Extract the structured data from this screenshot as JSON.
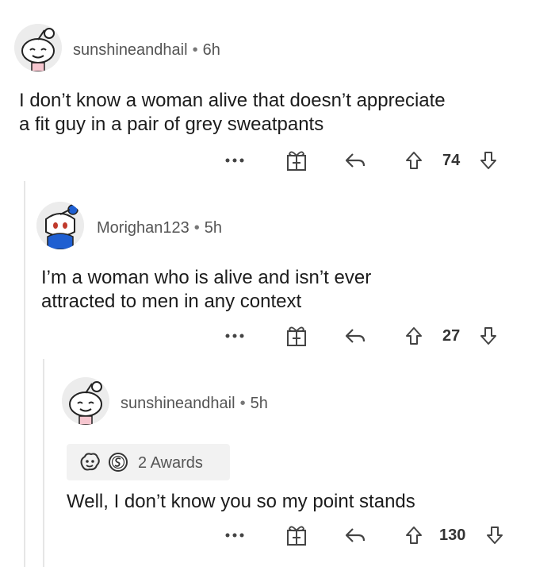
{
  "comments": [
    {
      "username": "sunshineandhail",
      "age": "6h",
      "text_lines": [
        "I don’t know a woman alive that doesn’t appreciate",
        "a fit guy in a pair of grey sweatpants"
      ],
      "votes": "74"
    },
    {
      "username": "Morighan123",
      "age": "5h",
      "text_lines": [
        "I’m a woman who is alive and isn’t ever",
        "attracted to men in any context"
      ],
      "votes": "27"
    },
    {
      "username": "sunshineandhail",
      "age": "5h",
      "awards_label": "2 Awards",
      "text_lines": [
        "Well, I don’t know you so my point stands"
      ],
      "votes": "130"
    }
  ],
  "separator": "•",
  "icons": {
    "more": "more-options-icon",
    "award": "gift-award-icon",
    "reply": "reply-icon",
    "upvote": "upvote-arrow-icon",
    "downvote": "downvote-arrow-icon"
  },
  "colors": {
    "thread_line": "#e6e6e6",
    "text": "#1c1c1c",
    "meta": "#555555",
    "icon": "#444444"
  }
}
